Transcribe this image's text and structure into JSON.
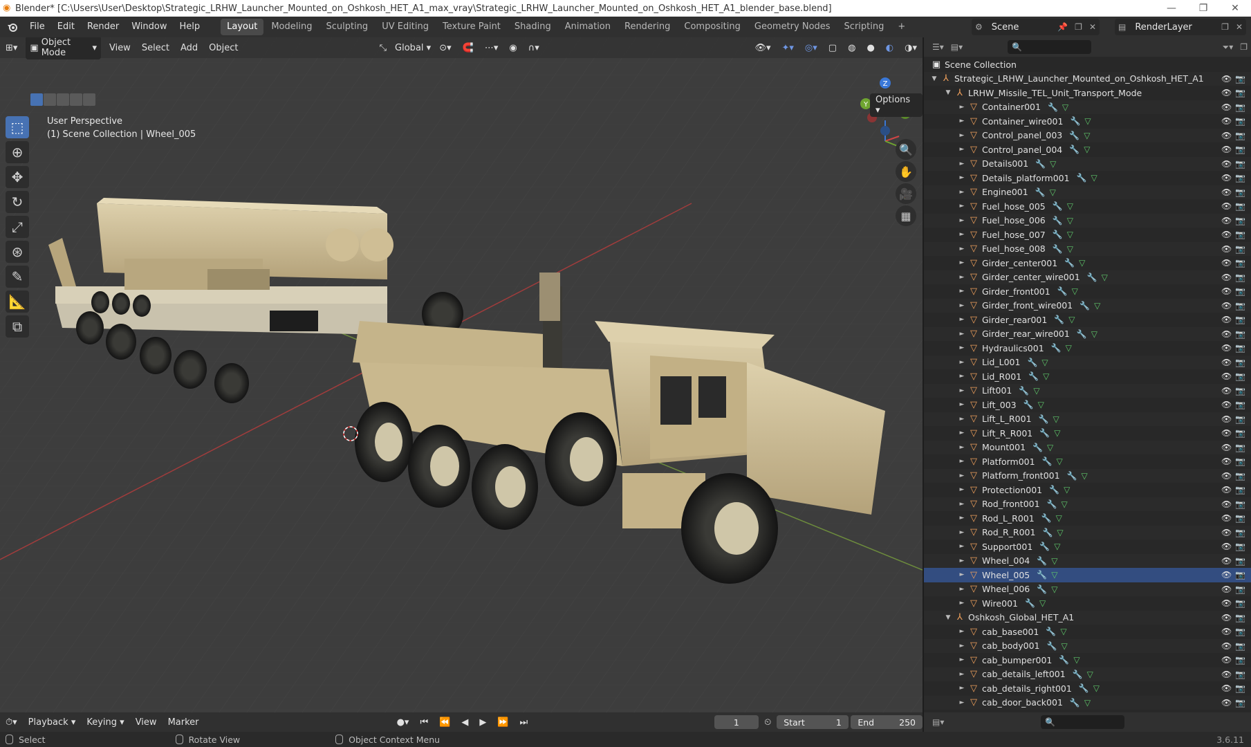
{
  "window": {
    "title": "Blender* [C:\\Users\\User\\Desktop\\Strategic_LRHW_Launcher_Mounted_on_Oshkosh_HET_A1_max_vray\\Strategic_LRHW_Launcher_Mounted_on_Oshkosh_HET_A1_blender_base.blend]"
  },
  "menu": [
    "File",
    "Edit",
    "Render",
    "Window",
    "Help"
  ],
  "workspaces": [
    "Layout",
    "Modeling",
    "Sculpting",
    "UV Editing",
    "Texture Paint",
    "Shading",
    "Animation",
    "Rendering",
    "Compositing",
    "Geometry Nodes",
    "Scripting"
  ],
  "active_workspace": "Layout",
  "scene_name": "Scene",
  "render_layer": "RenderLayer",
  "viewport": {
    "mode": "Object Mode",
    "menus": [
      "View",
      "Select",
      "Add",
      "Object"
    ],
    "orientation": "Global",
    "options_label": "Options",
    "perspective": "User Perspective",
    "context": "(1) Scene Collection | Wheel_005",
    "gizmo_axes": {
      "x": "X",
      "y": "Y",
      "z": "Z"
    }
  },
  "outliner": {
    "search_placeholder": "",
    "root": "Scene Collection",
    "rows": [
      {
        "label": "Strategic_LRHW_Launcher_Mounted_on_Oshkosh_HET_A1",
        "depth": 0,
        "kind": "empty",
        "expanded": true
      },
      {
        "label": "LRHW_Missile_TEL_Unit_Transport_Mode",
        "depth": 1,
        "kind": "empty",
        "expanded": true
      },
      {
        "label": "Container001",
        "depth": 2,
        "kind": "mesh"
      },
      {
        "label": "Container_wire001",
        "depth": 2,
        "kind": "mesh"
      },
      {
        "label": "Control_panel_003",
        "depth": 2,
        "kind": "mesh"
      },
      {
        "label": "Control_panel_004",
        "depth": 2,
        "kind": "mesh"
      },
      {
        "label": "Details001",
        "depth": 2,
        "kind": "mesh"
      },
      {
        "label": "Details_platform001",
        "depth": 2,
        "kind": "mesh"
      },
      {
        "label": "Engine001",
        "depth": 2,
        "kind": "mesh"
      },
      {
        "label": "Fuel_hose_005",
        "depth": 2,
        "kind": "mesh"
      },
      {
        "label": "Fuel_hose_006",
        "depth": 2,
        "kind": "mesh"
      },
      {
        "label": "Fuel_hose_007",
        "depth": 2,
        "kind": "mesh"
      },
      {
        "label": "Fuel_hose_008",
        "depth": 2,
        "kind": "mesh"
      },
      {
        "label": "Girder_center001",
        "depth": 2,
        "kind": "mesh"
      },
      {
        "label": "Girder_center_wire001",
        "depth": 2,
        "kind": "mesh"
      },
      {
        "label": "Girder_front001",
        "depth": 2,
        "kind": "mesh"
      },
      {
        "label": "Girder_front_wire001",
        "depth": 2,
        "kind": "mesh"
      },
      {
        "label": "Girder_rear001",
        "depth": 2,
        "kind": "mesh"
      },
      {
        "label": "Girder_rear_wire001",
        "depth": 2,
        "kind": "mesh"
      },
      {
        "label": "Hydraulics001",
        "depth": 2,
        "kind": "mesh"
      },
      {
        "label": "Lid_L001",
        "depth": 2,
        "kind": "mesh"
      },
      {
        "label": "Lid_R001",
        "depth": 2,
        "kind": "mesh"
      },
      {
        "label": "Lift001",
        "depth": 2,
        "kind": "mesh"
      },
      {
        "label": "Lift_003",
        "depth": 2,
        "kind": "mesh"
      },
      {
        "label": "Lift_L_R001",
        "depth": 2,
        "kind": "mesh"
      },
      {
        "label": "Lift_R_R001",
        "depth": 2,
        "kind": "mesh"
      },
      {
        "label": "Mount001",
        "depth": 2,
        "kind": "mesh"
      },
      {
        "label": "Platform001",
        "depth": 2,
        "kind": "mesh"
      },
      {
        "label": "Platform_front001",
        "depth": 2,
        "kind": "mesh"
      },
      {
        "label": "Protection001",
        "depth": 2,
        "kind": "mesh"
      },
      {
        "label": "Rod_front001",
        "depth": 2,
        "kind": "mesh"
      },
      {
        "label": "Rod_L_R001",
        "depth": 2,
        "kind": "mesh"
      },
      {
        "label": "Rod_R_R001",
        "depth": 2,
        "kind": "mesh"
      },
      {
        "label": "Support001",
        "depth": 2,
        "kind": "mesh"
      },
      {
        "label": "Wheel_004",
        "depth": 2,
        "kind": "mesh"
      },
      {
        "label": "Wheel_005",
        "depth": 2,
        "kind": "mesh",
        "selected": true
      },
      {
        "label": "Wheel_006",
        "depth": 2,
        "kind": "mesh"
      },
      {
        "label": "Wire001",
        "depth": 2,
        "kind": "mesh"
      },
      {
        "label": "Oshkosh_Global_HET_A1",
        "depth": 1,
        "kind": "empty",
        "expanded": true
      },
      {
        "label": "cab_base001",
        "depth": 2,
        "kind": "mesh"
      },
      {
        "label": "cab_body001",
        "depth": 2,
        "kind": "mesh"
      },
      {
        "label": "cab_bumper001",
        "depth": 2,
        "kind": "mesh"
      },
      {
        "label": "cab_details_left001",
        "depth": 2,
        "kind": "mesh"
      },
      {
        "label": "cab_details_right001",
        "depth": 2,
        "kind": "mesh"
      },
      {
        "label": "cab_door_back001",
        "depth": 2,
        "kind": "mesh"
      }
    ]
  },
  "timeline": {
    "menus": [
      "Playback",
      "Keying",
      "View",
      "Marker"
    ],
    "current_frame": "1",
    "start_label": "Start",
    "start": "1",
    "end_label": "End",
    "end": "250"
  },
  "statusbar": {
    "select": "Select",
    "rotate": "Rotate View",
    "context_menu": "Object Context Menu",
    "version": "3.6.11"
  },
  "colors": {
    "accent": "#4772b3",
    "grid_x": "#9b3a3a",
    "grid_y": "#6a8a3a",
    "vehicle": "#c8b68c"
  }
}
